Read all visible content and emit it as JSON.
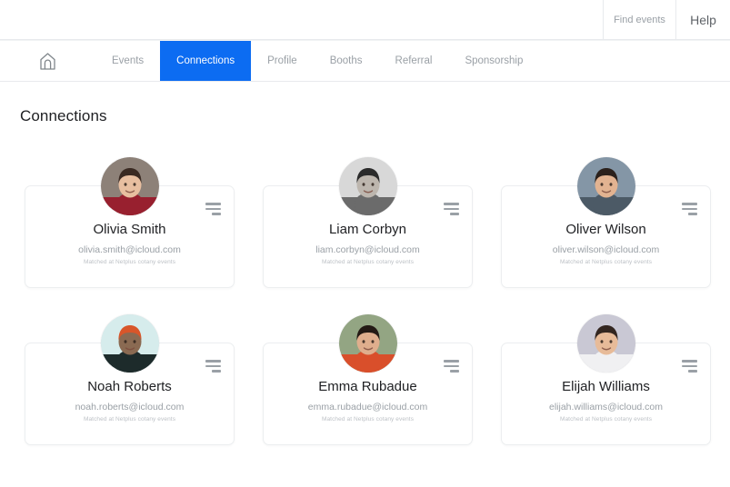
{
  "topbar": {
    "find_events_label": "Find events",
    "help_label": "Help"
  },
  "nav": {
    "home_icon": "home-icon",
    "items": [
      {
        "label": "Events",
        "active": false
      },
      {
        "label": "Connections",
        "active": true
      },
      {
        "label": "Profile",
        "active": false
      },
      {
        "label": "Booths",
        "active": false
      },
      {
        "label": "Referral",
        "active": false
      },
      {
        "label": "Sponsorship",
        "active": false
      }
    ],
    "active_color": "#0c6cf2"
  },
  "page": {
    "title": "Connections"
  },
  "cards": [
    {
      "name": "Olivia Smith",
      "email": "olivia.smith@icloud.com",
      "note": "Matched at Netplus cotany events",
      "menu_icon": "menu-lines-icon",
      "avatar": {
        "bg": "#8d8178",
        "skin": "#e8bfa0",
        "hair": "#3a2a22",
        "cloth": "#98202f"
      }
    },
    {
      "name": "Liam Corbyn",
      "email": "liam.corbyn@icloud.com",
      "note": "Matched at Netplus cotany events",
      "menu_icon": "menu-lines-icon",
      "avatar": {
        "bg": "#d8d8d8",
        "skin": "#bdb6ae",
        "hair": "#2b2b2b",
        "cloth": "#6b6b6b"
      }
    },
    {
      "name": "Oliver Wilson",
      "email": "oliver.wilson@icloud.com",
      "note": "Matched at Netplus cotany events",
      "menu_icon": "menu-lines-icon",
      "avatar": {
        "bg": "#8496a6",
        "skin": "#e2b391",
        "hair": "#2b211c",
        "cloth": "#4c5a66"
      }
    },
    {
      "name": "Noah Roberts",
      "email": "noah.roberts@icloud.com",
      "note": "Matched at Netplus cotany events",
      "menu_icon": "menu-lines-icon",
      "avatar": {
        "bg": "#d6ecec",
        "skin": "#8a6a52",
        "hair": "#d8562a",
        "cloth": "#1d2b2b"
      }
    },
    {
      "name": "Emma Rubadue",
      "email": "emma.rubadue@icloud.com",
      "note": "Matched at Netplus cotany events",
      "menu_icon": "menu-lines-icon",
      "avatar": {
        "bg": "#93a583",
        "skin": "#dfae8d",
        "hair": "#241a15",
        "cloth": "#d94f2b"
      }
    },
    {
      "name": "Elijah Williams",
      "email": "elijah.williams@icloud.com",
      "note": "Matched at Netplus cotany events",
      "menu_icon": "menu-lines-icon",
      "avatar": {
        "bg": "#c9c8d4",
        "skin": "#e7bb99",
        "hair": "#332620",
        "cloth": "#f0f0f2"
      }
    }
  ]
}
